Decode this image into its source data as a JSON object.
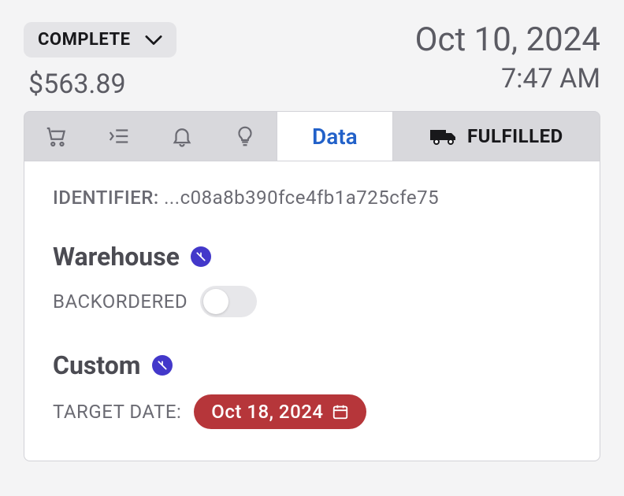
{
  "header": {
    "status_label": "COMPLETE",
    "amount": "$563.89",
    "date": "Oct 10, 2024",
    "time": "7:47 AM"
  },
  "tabs": {
    "data_label": "Data",
    "fulfilled_label": "FULFILLED"
  },
  "panel": {
    "identifier_label": "IDENTIFIER:",
    "identifier_value": "...c08a8b390fce4fb1a725cfe75",
    "warehouse_title": "Warehouse",
    "backordered_label": "BACKORDERED",
    "backordered_on": false,
    "custom_title": "Custom",
    "target_date_label": "TARGET DATE:",
    "target_date_value": "Oct 18, 2024"
  }
}
